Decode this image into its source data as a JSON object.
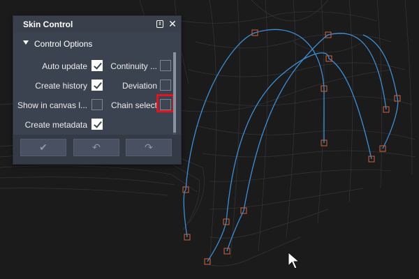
{
  "panel": {
    "title": "Skin Control",
    "section_title": "Control Options",
    "options": [
      {
        "label": "Auto update",
        "checked": true
      },
      {
        "label": "Continuity ...",
        "checked": false
      },
      {
        "label": "Create history",
        "checked": true
      },
      {
        "label": "Deviation",
        "checked": false
      },
      {
        "label": "Show in canvas l...",
        "checked": false
      },
      {
        "label": "Chain select",
        "checked": false,
        "highlighted": true
      },
      {
        "label": "Create metadata",
        "checked": true
      }
    ],
    "footer_buttons": [
      {
        "name": "apply-check-icon",
        "glyph": "✔"
      },
      {
        "name": "undo-icon",
        "glyph": "↶"
      },
      {
        "name": "redo-icon",
        "glyph": "↷"
      }
    ]
  },
  "viewport": {
    "background": "#1b1b1c",
    "curve_color": "#3d8fd6",
    "cv_color": "#c0603a",
    "highlight_color": "#e3141b"
  }
}
